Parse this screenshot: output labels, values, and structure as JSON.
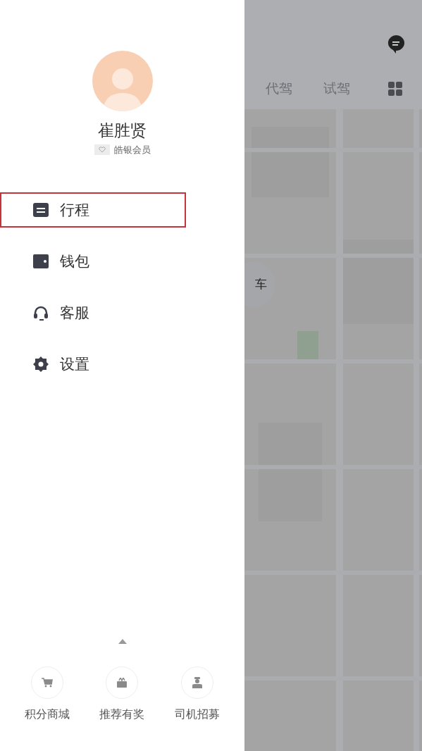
{
  "drawer": {
    "user": {
      "name": "崔胜贤",
      "membership": "皓银会员"
    },
    "menu": [
      {
        "kind": "trips",
        "label": "行程",
        "highlighted": true
      },
      {
        "kind": "wallet",
        "label": "钱包",
        "highlighted": false
      },
      {
        "kind": "support",
        "label": "客服",
        "highlighted": false
      },
      {
        "kind": "settings",
        "label": "设置",
        "highlighted": false
      }
    ],
    "shortcuts": [
      {
        "kind": "cart",
        "label": "积分商城"
      },
      {
        "kind": "gift",
        "label": "推荐有奖"
      },
      {
        "kind": "driver",
        "label": "司机招募"
      }
    ]
  },
  "background": {
    "tabs": [
      {
        "label": "代驾"
      },
      {
        "label": "试驾"
      }
    ],
    "pickup_button": {
      "label": "车"
    }
  }
}
